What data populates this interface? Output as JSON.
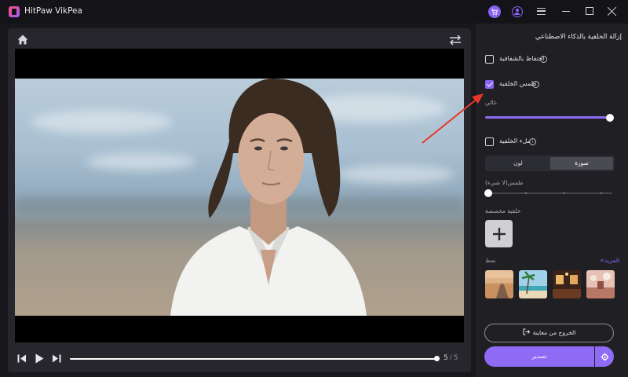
{
  "app": {
    "title": "HitPaw VikPea"
  },
  "player": {
    "current_frame": "5",
    "separator": "/",
    "total_frames": "5",
    "progress": 1.0
  },
  "panel": {
    "title": "إزالة الخلفية بالذكاء الاصطناعي",
    "keep_transparency": {
      "label": "احتفاظ بالشفافية",
      "checked": false
    },
    "blur_background": {
      "label": "طمس الخلفية",
      "checked": true,
      "level_label": "عالي",
      "level": 1.0
    },
    "fill_background": {
      "label": "ملء الخلفية",
      "checked": false
    },
    "fill_tabs": [
      {
        "label": "صورة",
        "active": true
      },
      {
        "label": "لون",
        "active": false
      }
    ],
    "blur_none_label": "طمس(لا شيء)",
    "blur_none_level": 0.0,
    "custom_bg_label": "خلفية مخصصة",
    "style_label": "نمط",
    "more_label": "المزيد>",
    "thumbnails": [
      "desert-road",
      "tropical-beach",
      "restaurant-interior",
      "cafe-interior"
    ],
    "exit_preview_label": "الخروج من معاينة",
    "export_label": "تصدير"
  },
  "colors": {
    "accent": "#8f6bf5",
    "panel_bg": "#1f1f24",
    "workspace_bg": "#26262c",
    "annotation": "#e8372a"
  }
}
